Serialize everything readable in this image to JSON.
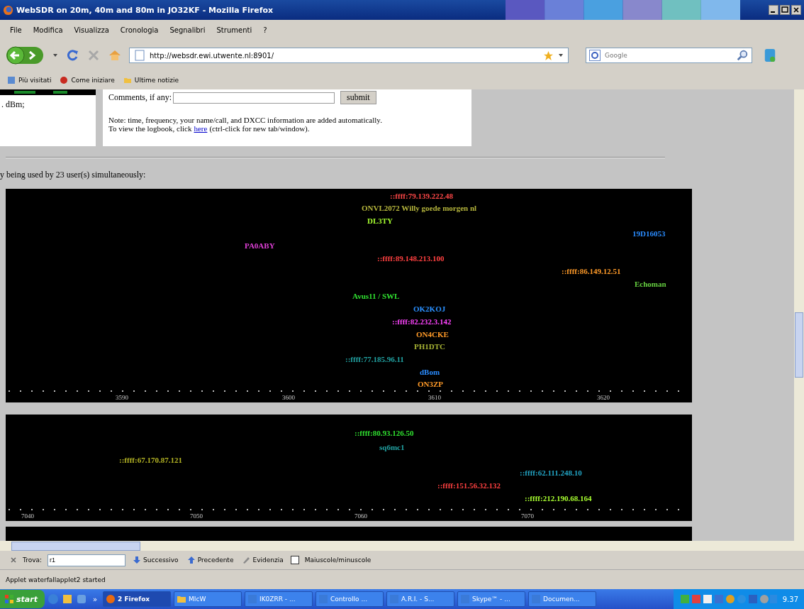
{
  "window": {
    "title": "WebSDR on 20m, 40m and 80m in JO32KF - Mozilla Firefox"
  },
  "menu": [
    "File",
    "Modifica",
    "Visualizza",
    "Cronologia",
    "Segnalibri",
    "Strumenti",
    "?"
  ],
  "toolbar": {
    "url": "http://websdr.ewi.utwente.nl:8901/",
    "search": {
      "placeholder": "Google"
    }
  },
  "bookmarks": [
    "Più visitati",
    "Come iniziare",
    "Ultime notizie"
  ],
  "page": {
    "left_fragment": ". dBm;",
    "comments": {
      "label": "Comments, if any:",
      "button": "submit"
    },
    "note": "Note: time, frequency, your name/call, and DXCC information are added automatically.",
    "logbook": {
      "before": "To view the logbook, click",
      "link": "here",
      "after": "(ctrl-click for new tab/window)."
    },
    "users_line": "y being used by 23 user(s) simultaneously:",
    "waterfalls": [
      {
        "labels": [
          {
            "text": "::ffff:79.139.222.48",
            "color": "#ff4848"
          },
          {
            "text": "ONVL2072 Willy goede morgen nl",
            "color": "#b4b43c"
          },
          {
            "text": "DL3TY",
            "color": "#a8ff30"
          },
          {
            "text": "19D16053",
            "color": "#2a8cff"
          },
          {
            "text": "PA0ABY",
            "color": "#e040d8"
          },
          {
            "text": "::ffff:89.148.213.100",
            "color": "#ff4040"
          },
          {
            "text": "::ffff:86.149.12.51",
            "color": "#ff9a28"
          },
          {
            "text": "Echoman",
            "color": "#66d040"
          },
          {
            "text": "Avus11 / SWL",
            "color": "#30e030"
          },
          {
            "text": "OK2KOJ",
            "color": "#2a90ff"
          },
          {
            "text": "::ffff:82.232.3.142",
            "color": "#ff44ff"
          },
          {
            "text": "ON4CKE",
            "color": "#ff9a28"
          },
          {
            "text": "PH1DTC",
            "color": "#a8b434"
          },
          {
            "text": "::ffff:77.185.96.11",
            "color": "#22a4a4"
          },
          {
            "text": "dBom",
            "color": "#2a8cff"
          },
          {
            "text": "ON3ZP",
            "color": "#ff9a28"
          }
        ],
        "ticks": [
          "3590",
          "3600",
          "3610",
          "3620"
        ]
      },
      {
        "labels": [
          {
            "text": "::ffff:80.93.126.50",
            "color": "#30e030"
          },
          {
            "text": "sq6mc1",
            "color": "#22a4a4"
          },
          {
            "text": "::ffff:67.170.87.121",
            "color": "#b4b424"
          },
          {
            "text": "::ffff:62.111.248.10",
            "color": "#22a4c4"
          },
          {
            "text": "::ffff:151.56.32.132",
            "color": "#ff4040"
          },
          {
            "text": "::ffff:212.190.68.164",
            "color": "#a8ff30"
          }
        ],
        "ticks": [
          "7040",
          "7050",
          "7060",
          "7070"
        ]
      }
    ]
  },
  "find_bar": {
    "label": "Trova:",
    "value": "r1",
    "next": "Successivo",
    "previous": "Precedente",
    "highlight": "Evidenzia",
    "match_case": {
      "label": "Maiuscole/minuscole",
      "checked": false
    }
  },
  "status_bar": "Applet waterfallapplet2 started",
  "taskbar": {
    "start": "start",
    "chevron": "»",
    "tasks": [
      {
        "label": "2 Firefox",
        "kind": "group",
        "selected": true
      },
      {
        "label": "MIcW",
        "kind": "folder",
        "selected": false
      },
      {
        "label": "IK0ZRR - ...",
        "kind": "app",
        "selected": false
      },
      {
        "label": "Controllo ...",
        "kind": "app",
        "selected": false
      },
      {
        "label": "A.R.I. - S...",
        "kind": "app",
        "selected": false
      },
      {
        "label": "Skype™ - ...",
        "kind": "app",
        "selected": false
      },
      {
        "label": "Documen...",
        "kind": "app",
        "selected": false
      }
    ],
    "clock": "9.37"
  }
}
